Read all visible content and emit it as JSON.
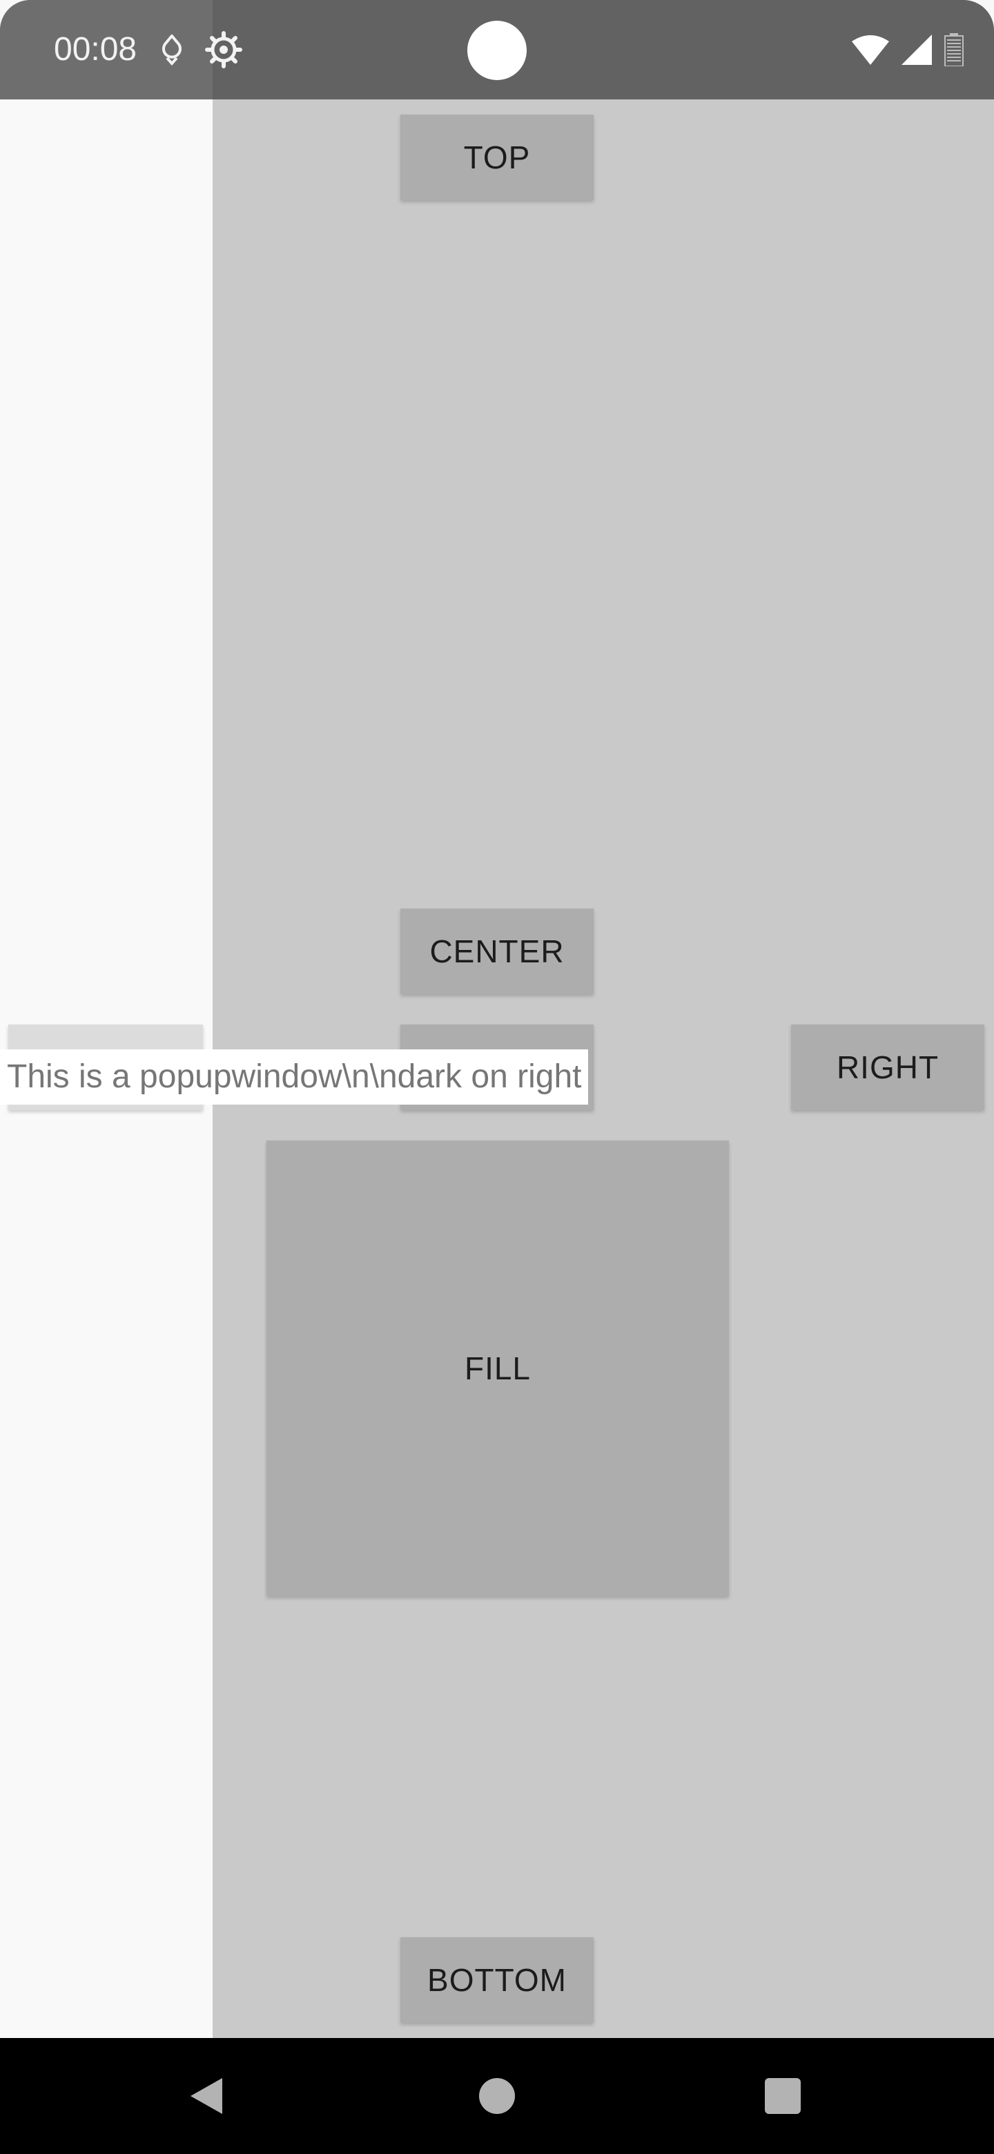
{
  "status_bar": {
    "time": "00:08",
    "icons": [
      "notification-drop-icon",
      "settings-gear-icon",
      "wifi-icon",
      "cell-signal-icon",
      "battery-icon"
    ]
  },
  "buttons": {
    "top": "TOP",
    "center": "CENTER",
    "left": "",
    "middle": "",
    "right": "RIGHT",
    "fill": "FILL",
    "bottom": "BOTTOM"
  },
  "popup": {
    "text": "This is a popupwindow\\n\\ndark on right"
  },
  "nav_bar": {
    "icons": [
      "back-icon",
      "home-icon",
      "recents-icon"
    ]
  },
  "colors": {
    "status_bar": "#626262",
    "app_background": "#c9c9c9",
    "popup_panel": "#f9f9f9",
    "button": "#acadac",
    "nav_bar": "#000000"
  }
}
